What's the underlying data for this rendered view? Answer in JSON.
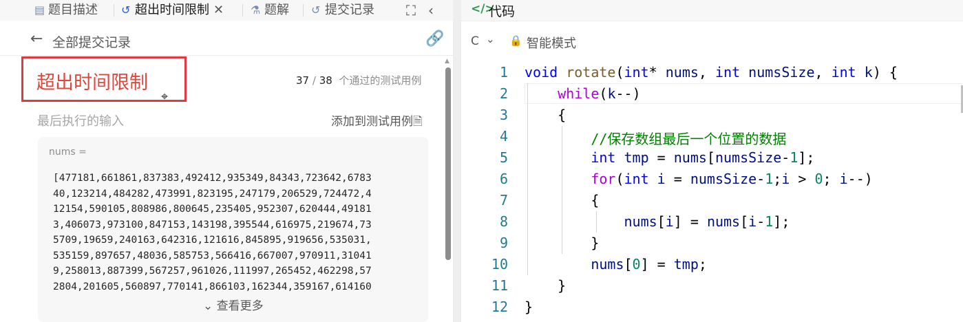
{
  "tabs": [
    {
      "icon": "document-icon",
      "label": "题目描述"
    },
    {
      "icon": "history-icon",
      "label": "超出时间限制"
    },
    {
      "icon": "flask-icon",
      "label": "题解"
    },
    {
      "icon": "history-icon",
      "label": "提交记录"
    }
  ],
  "subheader": {
    "title": "全部提交记录"
  },
  "result": {
    "status": "超出时间限制",
    "passed_count": "37",
    "slash": "/",
    "total_count": "38",
    "passed_suffix": "个通过的测试用例"
  },
  "last_input": {
    "label": "最后执行的输入",
    "add_testcase": "添加到测试用例",
    "param_name": "nums =",
    "value_lines": [
      "[477181,661861,837383,492412,935349,84343,723642,6783",
      "40,123214,484282,473991,823195,247179,206529,724472,4",
      "12154,590105,808986,800645,235405,952307,620444,49181",
      "3,406073,973100,847153,143198,395544,616975,219674,73",
      "5709,19659,240163,642316,121616,845895,919656,535031,",
      "535159,897657,48036,585753,566416,667007,970911,31041",
      "9,258013,887399,567257,961026,111997,265452,462298,57",
      "2804,201605,560897,770141,866103,162344,359167,614160"
    ],
    "more": "查看更多"
  },
  "code_panel": {
    "title": "代码",
    "language": "C",
    "mode": "智能模式",
    "line_numbers": [
      "1",
      "2",
      "3",
      "4",
      "5",
      "6",
      "7",
      "8",
      "9",
      "10",
      "11",
      "12"
    ],
    "lines": [
      "void rotate(int* nums, int numsSize, int k) {",
      "    while(k--)",
      "    {",
      "        //保存数组最后一个位置的数据",
      "        int tmp = nums[numsSize-1];",
      "        for(int i = numsSize-1;i > 0; i--)",
      "        {",
      "            nums[i] = nums[i-1];",
      "        }",
      "        nums[0] = tmp;",
      "    }",
      "}"
    ]
  },
  "colors": {
    "error": "#e0473c",
    "highlight_border": "#e0393e",
    "keyword": "#0000ff",
    "control": "#af00db",
    "function": "#795e26",
    "variable": "#001080",
    "number": "#098658",
    "comment": "#008000",
    "line_number": "#237893"
  }
}
